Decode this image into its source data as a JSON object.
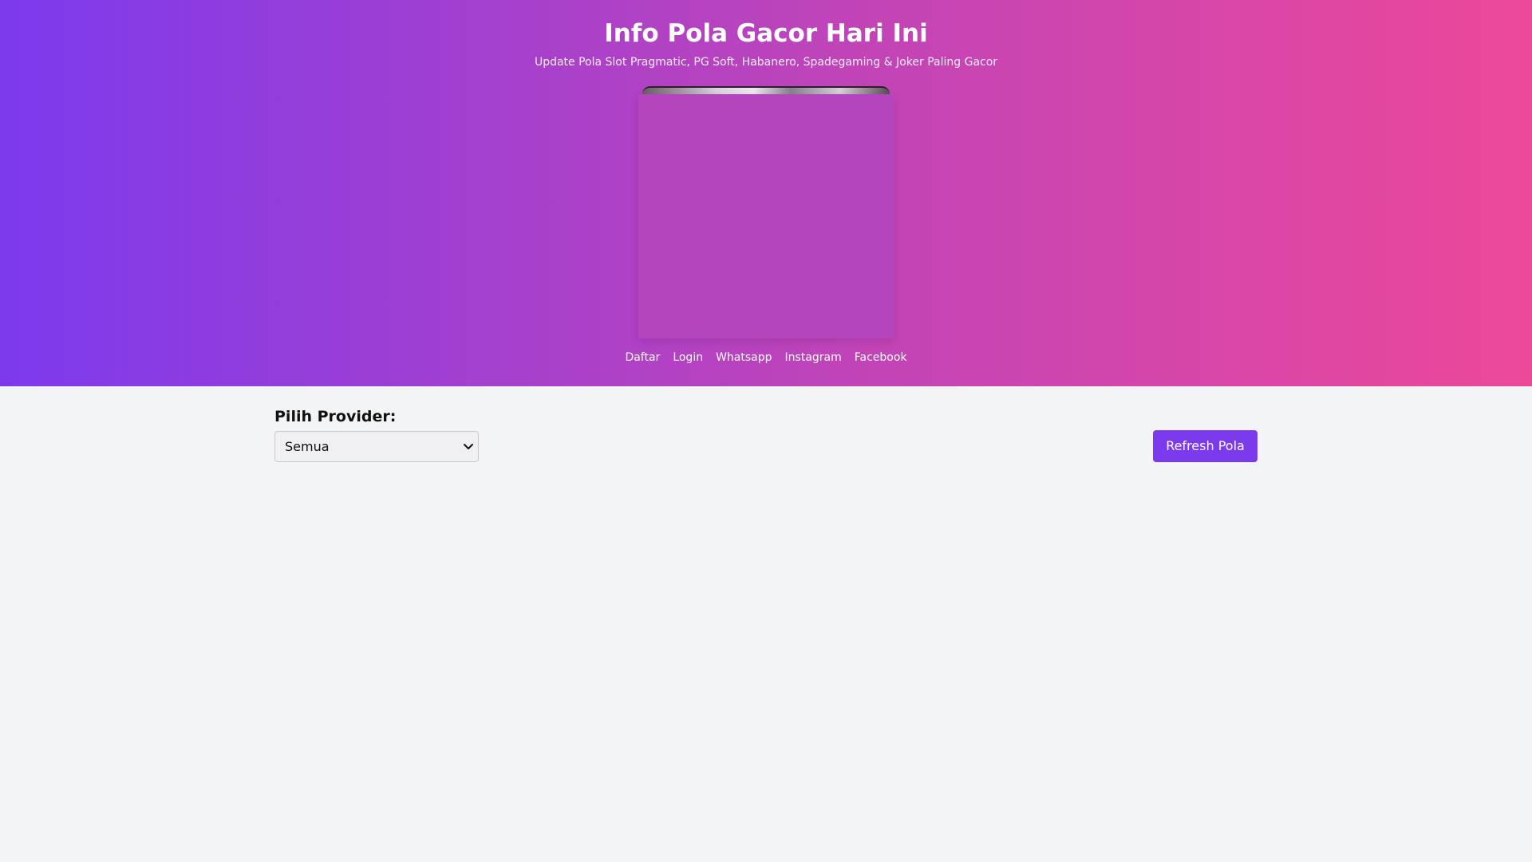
{
  "header": {
    "title": "Info Pola Gacor Hari Ini",
    "subtitle": "Update Pola Slot Pragmatic, PG Soft, Habanero, Spadegaming & Joker Paling Gacor"
  },
  "nav": {
    "items": [
      {
        "label": "Daftar"
      },
      {
        "label": "Login"
      },
      {
        "label": "Whatsapp"
      },
      {
        "label": "Instagram"
      },
      {
        "label": "Facebook"
      }
    ]
  },
  "filter": {
    "label": "Pilih Provider:",
    "selected": "Semua",
    "refresh_label": "Refresh Pola"
  },
  "colors": {
    "accent": "#7c3aed",
    "gradient_start": "#7c3aed",
    "gradient_end": "#ec4899",
    "background": "#f3f4f6"
  },
  "icons": {
    "select_arrow": "chevron-down-icon"
  }
}
